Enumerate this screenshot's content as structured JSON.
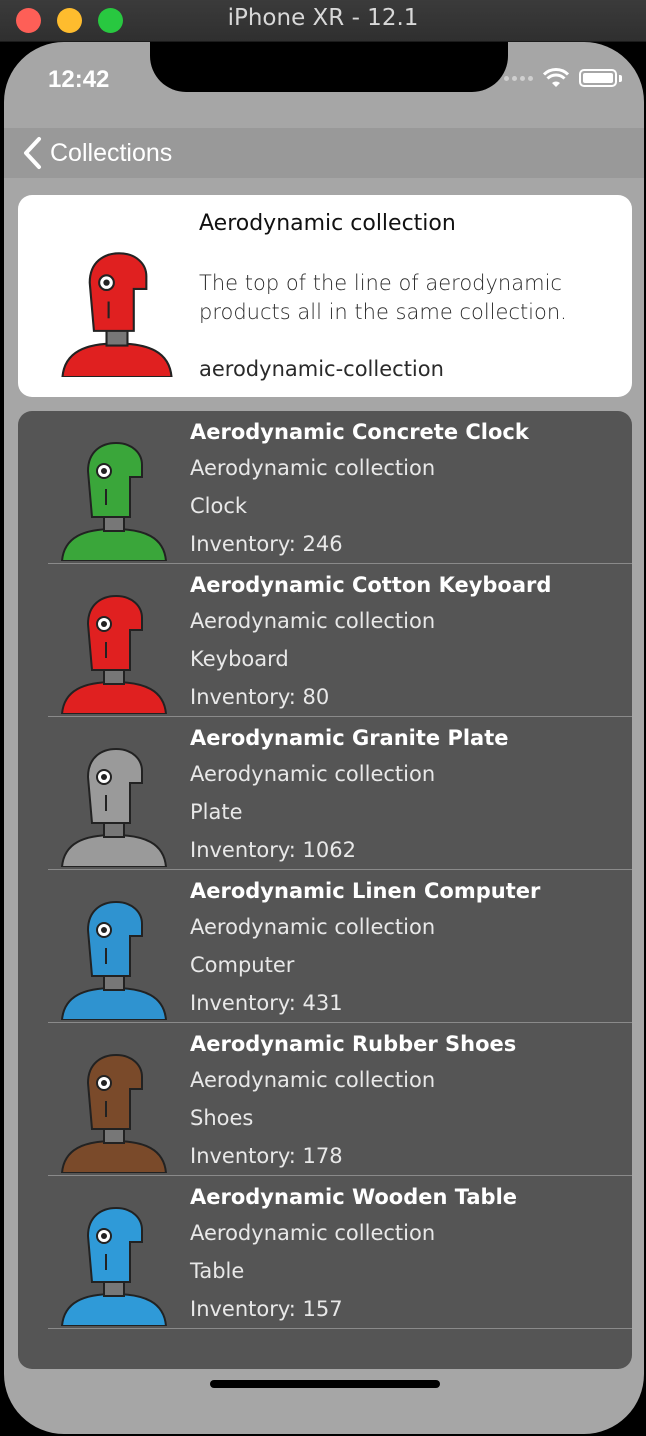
{
  "window": {
    "title": "iPhone XR - 12.1"
  },
  "status_bar": {
    "time": "12:42"
  },
  "nav": {
    "back_label": "Collections"
  },
  "collection": {
    "title": "Aerodynamic collection",
    "description": "The top of the line of aerodynamic products all in the same collection.",
    "handle": "aerodynamic-collection",
    "image_icon": "red-robot-icon"
  },
  "products": [
    {
      "title": "Aerodynamic Concrete Clock",
      "collection": "Aerodynamic collection",
      "type": "Clock",
      "inventory": "Inventory: 246",
      "icon": "green-robot-icon",
      "color": "#3aa63a"
    },
    {
      "title": "Aerodynamic Cotton Keyboard",
      "collection": "Aerodynamic collection",
      "type": "Keyboard",
      "inventory": "Inventory: 80",
      "icon": "red-robot-icon",
      "color": "#e02020"
    },
    {
      "title": "Aerodynamic Granite Plate",
      "collection": "Aerodynamic collection",
      "type": "Plate",
      "inventory": "Inventory: 1062",
      "icon": "gray-robot-icon",
      "color": "#9a9a9a"
    },
    {
      "title": "Aerodynamic Linen Computer",
      "collection": "Aerodynamic collection",
      "type": "Computer",
      "inventory": "Inventory: 431",
      "icon": "blue-antenna-robot-icon",
      "color": "#2f93d0"
    },
    {
      "title": "Aerodynamic Rubber Shoes",
      "collection": "Aerodynamic collection",
      "type": "Shoes",
      "inventory": "Inventory: 178",
      "icon": "brown-robot-icon",
      "color": "#7a4a2a"
    },
    {
      "title": "Aerodynamic Wooden Table",
      "collection": "Aerodynamic collection",
      "type": "Table",
      "inventory": "Inventory: 157",
      "icon": "blue-robot-icon",
      "color": "#2f9ad8"
    }
  ]
}
